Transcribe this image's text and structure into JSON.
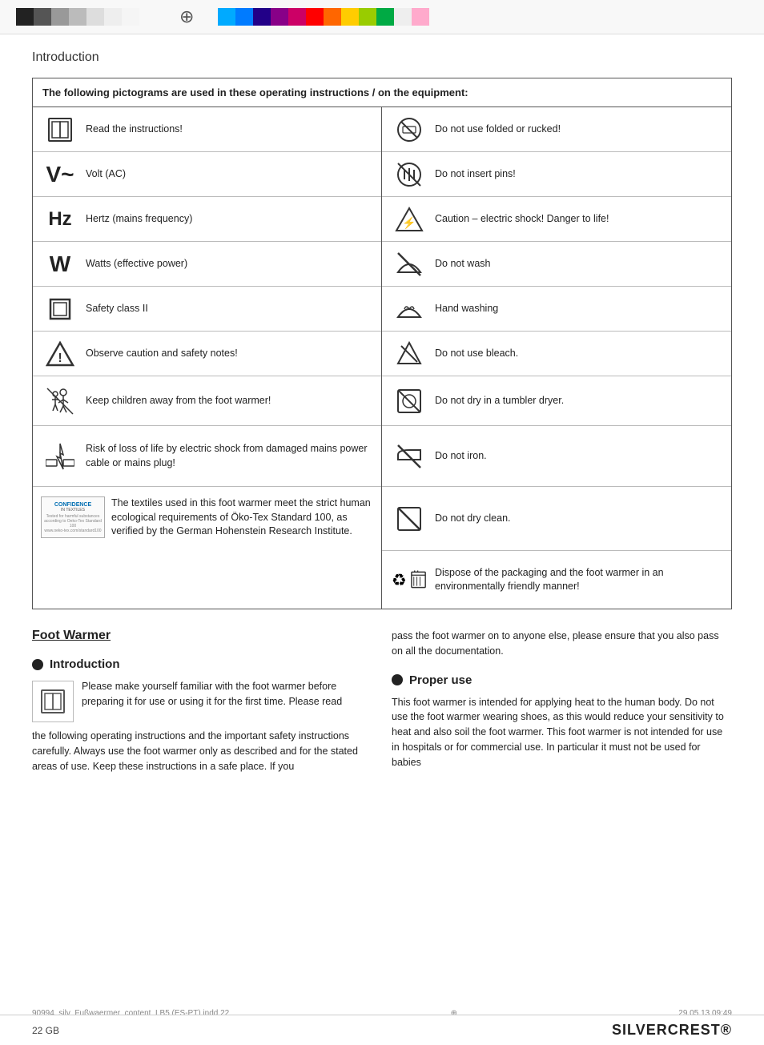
{
  "page": {
    "title": "Introduction"
  },
  "pictogramTable": {
    "header": "The following pictograms are used in these operating instructions / on the equipment:",
    "items": [
      {
        "icon": "book",
        "text": "Read the instructions!"
      },
      {
        "icon": "volt",
        "text": "Volt (AC)"
      },
      {
        "icon": "hz",
        "text": "Hertz (mains frequency)"
      },
      {
        "icon": "watts",
        "text": "Watts (effective power)"
      },
      {
        "icon": "safety-class",
        "text": "Safety class II"
      },
      {
        "icon": "caution",
        "text": "Observe caution and safety notes!"
      },
      {
        "icon": "children",
        "text": "Keep children away from the foot warmer!"
      },
      {
        "icon": "electric",
        "text": "Risk of loss of life by electric shock from damaged mains power cable or mains plug!"
      },
      {
        "icon": "oekotex",
        "text": "The textiles used in this foot warmer meet the strict human ecological requirements of Öko-Tex Standard 100, as verified by the German Hohenstein Research Institute."
      },
      {
        "icon": "no-folded",
        "text": "Do not use folded or rucked!"
      },
      {
        "icon": "no-pins",
        "text": "Do not insert pins!"
      },
      {
        "icon": "elec-danger",
        "text": "Caution – electric shock!\nDanger to life!"
      },
      {
        "icon": "no-wash",
        "text": "Do not wash"
      },
      {
        "icon": "hand-wash",
        "text": "Hand washing"
      },
      {
        "icon": "no-bleach",
        "text": "Do not use bleach."
      },
      {
        "icon": "no-tumble",
        "text": "Do not dry in a tumbler dryer."
      },
      {
        "icon": "no-iron",
        "text": "Do not iron."
      },
      {
        "icon": "no-dry-clean",
        "text": "Do not dry clean."
      },
      {
        "icon": "dispose",
        "text": "Dispose of the packaging and the foot warmer in an environmentally friendly manner!"
      }
    ]
  },
  "footWarmer": {
    "title": "Foot Warmer",
    "introSection": {
      "heading": "Introduction",
      "text1": "Please make yourself familiar with the foot warmer before preparing it for use or using it for the first time. Please read",
      "text2": "the following operating instructions and the important safety instructions carefully. Always use the foot warmer only as described and for the stated areas of use. Keep these instructions in a safe place. If you",
      "textRight": "pass the foot warmer on to anyone else, please ensure that you also pass on all the documentation."
    },
    "properUseSection": {
      "heading": "Proper use",
      "text": "This foot warmer is intended for applying heat to the human body. Do not use the foot warmer wearing shoes, as this would reduce your sensitivity to heat and also soil the foot warmer. This foot warmer is not intended for use in hospitals or for commercial use. In particular it must not be used for babies"
    }
  },
  "footer": {
    "pageNum": "22    GB",
    "brand": "SILVERCREST®",
    "file": "90994_silv_Fußwaermer_content_LB5 (ES-PT).indd   22",
    "date": "29.05.13   09:49"
  }
}
